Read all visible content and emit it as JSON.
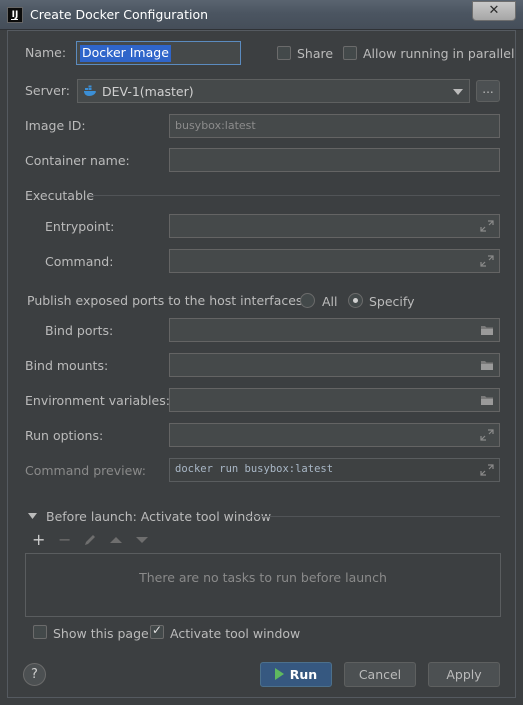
{
  "window": {
    "title": "Create Docker Configuration",
    "close_label": "✕"
  },
  "name": {
    "label": "Name:",
    "value": "Docker Image"
  },
  "share": {
    "label": "Share",
    "checked": false
  },
  "parallel": {
    "label": "Allow running in parallel",
    "checked": false
  },
  "server": {
    "label": "Server:",
    "value": "DEV-1(master)",
    "more_label": "..."
  },
  "image_id": {
    "label": "Image ID:",
    "value": "busybox:latest"
  },
  "container_name": {
    "label": "Container name:",
    "value": ""
  },
  "executable": {
    "section_label": "Executable",
    "entrypoint_label": "Entrypoint:",
    "command_label": "Command:"
  },
  "ports": {
    "publish_label": "Publish exposed ports to the host interfaces:",
    "options": [
      "All",
      "Specify"
    ],
    "selected": "Specify",
    "bind_ports_label": "Bind ports:"
  },
  "bind_mounts_label": "Bind mounts:",
  "env_vars_label": "Environment variables:",
  "run_options_label": "Run options:",
  "command_preview": {
    "label": "Command preview:",
    "value": "docker run busybox:latest"
  },
  "before_launch": {
    "label": "Before launch: Activate tool window",
    "empty_text": "There are no tasks to run before launch",
    "toolbar": [
      "add",
      "remove",
      "edit",
      "move-up",
      "move-down"
    ]
  },
  "show_page": {
    "label": "Show this page",
    "checked": false
  },
  "activate_tool_window": {
    "label": "Activate tool window",
    "checked": true
  },
  "buttons": {
    "help": "?",
    "run": "Run",
    "cancel": "Cancel",
    "apply": "Apply"
  },
  "colors": {
    "background": "#3c3f41",
    "accent": "#365880",
    "selection": "#2f65ca",
    "run_icon": "#5fb95f"
  }
}
